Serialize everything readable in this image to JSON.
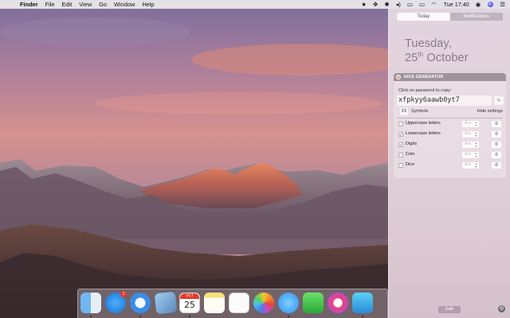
{
  "menubar": {
    "apple_icon": "apple-icon",
    "app_name": "Finder",
    "menus": [
      "File",
      "Edit",
      "View",
      "Go",
      "Window",
      "Help"
    ],
    "status_icons": [
      "wifi-icon",
      "bluetooth-icon",
      "dropbox-icon",
      "volume-icon",
      "airplay-icon",
      "battery-icon",
      "flag-icon"
    ],
    "clock": "Tue 17:40"
  },
  "notification_center": {
    "tabs": [
      {
        "label": "Today",
        "active": true
      },
      {
        "label": "Notifications",
        "active": false
      }
    ],
    "day": "Tuesday,",
    "date_day": "25",
    "date_suffix": "th",
    "date_month": "October",
    "widget": {
      "title": "NICE GENERATOR",
      "hint": "Click on password to copy:",
      "password": "xfpkyy6aawb0yt7",
      "length": "15",
      "symbols_label": "Symbols",
      "hide_settings": "Hide settings",
      "options": [
        {
          "label": "Uppercase letters",
          "checked": false,
          "count": "0"
        },
        {
          "label": "Lowercase letters",
          "checked": true,
          "count": "0"
        },
        {
          "label": "Digits",
          "checked": true,
          "count": "0"
        },
        {
          "label": "Coin",
          "checked": false,
          "count": "0"
        },
        {
          "label": "Dice",
          "checked": false,
          "count": "0"
        }
      ]
    },
    "edit_label": "Edit"
  },
  "dock": {
    "calendar_month": "OCT",
    "calendar_day": "25",
    "app_store_badge": "1",
    "apps": [
      "finder-icon",
      "app-store-icon",
      "safari-icon",
      "preview-icon",
      "calendar-icon",
      "notes-icon",
      "reminders-icon",
      "photos-icon",
      "messages-icon",
      "facetime-icon",
      "itunes-icon",
      "tweetbot-icon"
    ]
  },
  "colors": {
    "menubar_bg": "#ECEAEE",
    "panel_bg": "#E6D8E0",
    "accent_text": "#8A7A8A",
    "badge_red": "#E8372B"
  }
}
